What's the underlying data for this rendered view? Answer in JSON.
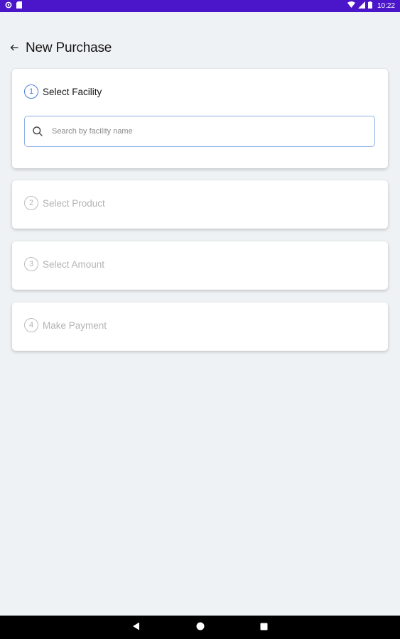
{
  "status_bar": {
    "time": "10:22",
    "icons": [
      "settings-icon",
      "sd-card-icon",
      "wifi-icon",
      "signal-icon",
      "battery-icon"
    ]
  },
  "header": {
    "back_icon": "arrow-left-icon",
    "title": "New Purchase"
  },
  "steps": [
    {
      "number": "1",
      "label": "Select Facility",
      "active": true
    },
    {
      "number": "2",
      "label": "Select Product",
      "active": false
    },
    {
      "number": "3",
      "label": "Select Amount",
      "active": false
    },
    {
      "number": "4",
      "label": "Make Payment",
      "active": false
    }
  ],
  "search": {
    "placeholder": "Search by facility name",
    "value": ""
  },
  "navigation_bar": {
    "buttons": [
      "back-triangle-icon",
      "home-circle-icon",
      "recents-square-icon"
    ]
  },
  "colors": {
    "status_bar": "#4b16c9",
    "accent": "#4d7ce0",
    "background": "#eff2f5",
    "inactive_text": "#b3b3b3"
  }
}
